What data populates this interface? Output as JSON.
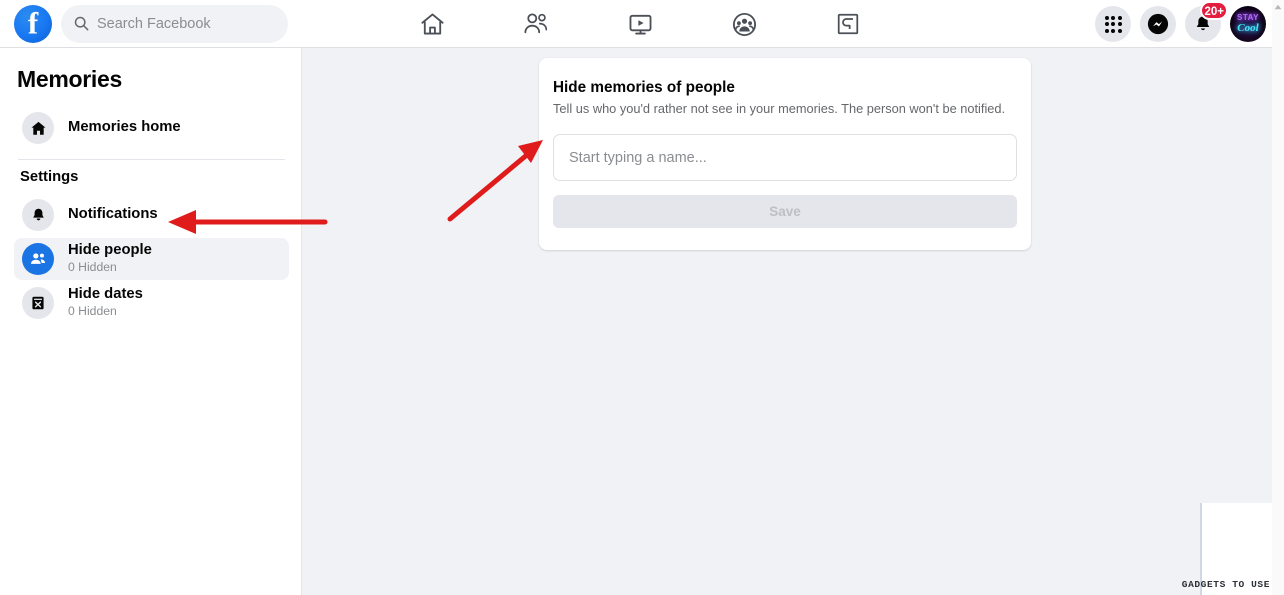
{
  "header": {
    "logo_icon": "facebook-logo-icon",
    "logo_glyph": "f",
    "search": {
      "icon": "search-icon",
      "placeholder": "Search Facebook",
      "value": ""
    },
    "nav_items": [
      {
        "name": "nav-home",
        "icon": "home-icon",
        "label": "Home"
      },
      {
        "name": "nav-friends",
        "icon": "friends-icon",
        "label": "Friends"
      },
      {
        "name": "nav-watch",
        "icon": "watch-video-icon",
        "label": "Watch"
      },
      {
        "name": "nav-groups",
        "icon": "groups-icon",
        "label": "Groups"
      },
      {
        "name": "nav-gaming",
        "icon": "gaming-icon",
        "label": "Gaming"
      }
    ],
    "right_items": [
      {
        "name": "menu-grid-button",
        "icon": "grid-menu-icon",
        "label": "Menu"
      },
      {
        "name": "messenger-button",
        "icon": "messenger-icon",
        "label": "Messenger"
      },
      {
        "name": "notifications-button",
        "icon": "bell-icon",
        "label": "Notifications",
        "badge": "20+"
      },
      {
        "name": "profile-avatar",
        "icon": "avatar-icon",
        "label": "Profile"
      }
    ],
    "notification_badge": "20+",
    "avatar_text_line1": "STAY",
    "avatar_text_line2": "Cool"
  },
  "sidebar": {
    "title": "Memories",
    "home_item": {
      "label": "Memories home",
      "icon": "home-filled-icon"
    },
    "section_label": "Settings",
    "items": [
      {
        "label": "Notifications",
        "sublabel": "",
        "icon": "bell-filled-icon",
        "active": false
      },
      {
        "label": "Hide people",
        "sublabel": "0 Hidden",
        "icon": "people-filled-icon",
        "active": true
      },
      {
        "label": "Hide dates",
        "sublabel": "0 Hidden",
        "icon": "calendar-x-icon",
        "active": false
      }
    ]
  },
  "main": {
    "card": {
      "title": "Hide memories of people",
      "description": "Tell us who you'd rather not see in your memories. The person won't be notified.",
      "input": {
        "placeholder": "Start typing a name...",
        "value": ""
      },
      "save_label": "Save",
      "save_disabled": true
    }
  },
  "annotations": [
    {
      "name": "arrow-to-name-input",
      "direction": "up-right",
      "color": "#e01b1b"
    },
    {
      "name": "arrow-to-hide-people",
      "direction": "left",
      "color": "#e01b1b"
    }
  ],
  "watermark": {
    "text": "GADGETS TO USE"
  },
  "colors": {
    "brand_blue": "#1877f2",
    "active_blue": "#1b74e4",
    "page_bg": "#f0f2f5",
    "card_bg": "#ffffff",
    "text_primary": "#050505",
    "text_secondary": "#65676b",
    "text_muted": "#8a8d91",
    "badge_red": "#e41e3f",
    "annotation_red": "#e01b1b",
    "disabled_btn_bg": "#e4e6eb",
    "disabled_btn_text": "#bcc0c4"
  }
}
